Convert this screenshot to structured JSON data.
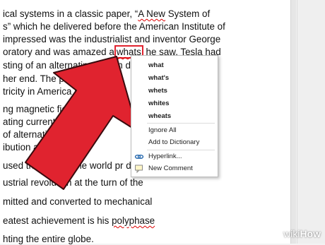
{
  "document": {
    "lines": [
      {
        "pre": "ical systems in a classic paper, “",
        "squiggle": "A  New",
        "post": " System of"
      },
      {
        "text": "s” which he delivered before the American Institute of"
      },
      {
        "text": "impressed was the industrialist and inventor George"
      },
      {
        "pre": "oratory and was amazed a",
        "highlight": "whats",
        "post": " he saw. Tesla had"
      },
      {
        "text": "sting of an alternating curren     dynamo            ep-"
      },
      {
        "text": "her end. The perfect part        by"
      },
      {
        "text": "tricity in America ha"
      },
      {
        "text": "ng magnetic field           al p"
      },
      {
        "text": "ating current        d"
      },
      {
        "pre": "of alternating cur",
        "post": "              ",
        "tail": "e"
      },
      {
        "text": "ibution and use c"
      },
      {
        "text": "used throughout the world pr     du"
      },
      {
        "text": "ustrial revolution at the turn of the"
      },
      {
        "text": "mitted and converted to mechanical"
      },
      {
        "pre": "eatest achievement is his ",
        "squiggle": "polyphase"
      },
      {
        "text": "hting the entire globe."
      }
    ]
  },
  "context_menu": {
    "suggestions": [
      "what",
      "what's",
      "whets",
      "whites",
      "wheats"
    ],
    "ignore_all": "Ignore All",
    "add_to_dictionary": "Add to Dictionary",
    "hyperlink": "Hyperlink...",
    "new_comment": "New Comment",
    "icons": {
      "hyperlink": "hyperlink-icon",
      "new_comment": "comment-icon"
    }
  },
  "overlay": {
    "arrow_color": "#e0232f",
    "highlight_color": "#e0232f",
    "watermark_prefix": "wiki",
    "watermark_suffix": "How"
  }
}
